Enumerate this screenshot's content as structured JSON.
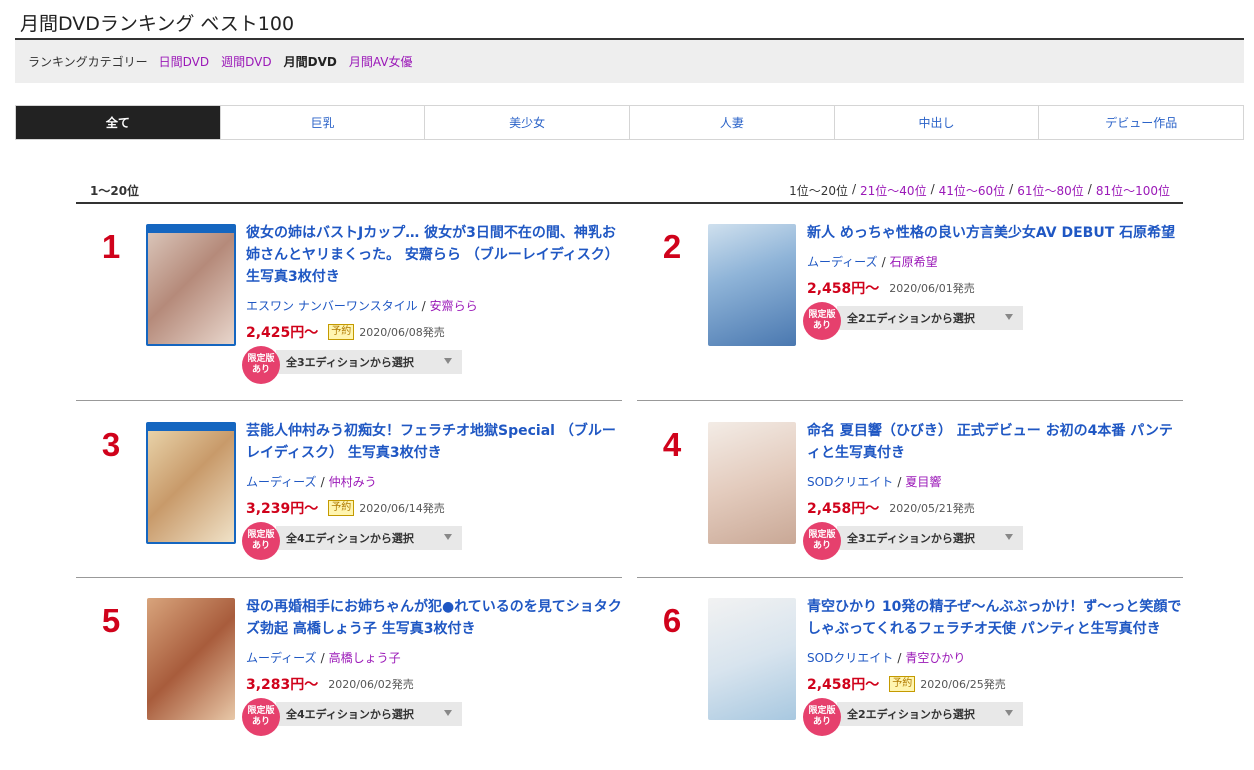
{
  "page_title": "月間DVDランキング ベスト100",
  "category_bar": {
    "label": "ランキングカテゴリー",
    "links": [
      {
        "label": "日間DVD",
        "active": false
      },
      {
        "label": "週間DVD",
        "active": false
      },
      {
        "label": "月間DVD",
        "active": true
      },
      {
        "label": "月間AV女優",
        "active": false
      }
    ]
  },
  "tabs": [
    {
      "label": "全て",
      "active": true
    },
    {
      "label": "巨乳",
      "active": false
    },
    {
      "label": "美少女",
      "active": false
    },
    {
      "label": "人妻",
      "active": false
    },
    {
      "label": "中出し",
      "active": false
    },
    {
      "label": "デビュー作品",
      "active": false
    }
  ],
  "range": {
    "current": "1〜20位",
    "nav": [
      "1位〜20位",
      "21位〜40位",
      "41位〜60位",
      "61位〜80位",
      "81位〜100位"
    ]
  },
  "items": [
    {
      "rank": "1",
      "title": "彼女の姉はバストJカップ… 彼女が3日間不在の間、神乳お姉さんとヤリまくった。 安齋らら （ブルーレイディスク） 生写真3枚付き",
      "maker": "エスワン ナンバーワンスタイル",
      "actress": "安齋らら",
      "price": "2,425円〜",
      "reserve": "予約",
      "release": "2020/06/08発売",
      "badge": "限定版あり",
      "edition": "全3エディションから選択"
    },
    {
      "rank": "2",
      "title": "新人 めっちゃ性格の良い方言美少女AV DEBUT 石原希望",
      "maker": "ムーディーズ",
      "actress": "石原希望",
      "price": "2,458円〜",
      "reserve": "",
      "release": "2020/06/01発売",
      "badge": "限定版あり",
      "edition": "全2エディションから選択"
    },
    {
      "rank": "3",
      "title": "芸能人仲村みう初痴女！フェラチオ地獄Special （ブルーレイディスク） 生写真3枚付き",
      "maker": "ムーディーズ",
      "actress": "仲村みう",
      "price": "3,239円〜",
      "reserve": "予約",
      "release": "2020/06/14発売",
      "badge": "限定版あり",
      "edition": "全4エディションから選択"
    },
    {
      "rank": "4",
      "title": "命名 夏目響（ひびき） 正式デビュー お初の4本番 パンティと生写真付き",
      "maker": "SODクリエイト",
      "actress": "夏目響",
      "price": "2,458円〜",
      "reserve": "",
      "release": "2020/05/21発売",
      "badge": "限定版あり",
      "edition": "全3エディションから選択"
    },
    {
      "rank": "5",
      "title": "母の再婚相手にお姉ちゃんが犯●れているのを見てショタクズ勃起 高橋しょう子 生写真3枚付き",
      "maker": "ムーディーズ",
      "actress": "高橋しょう子",
      "price": "3,283円〜",
      "reserve": "",
      "release": "2020/06/02発売",
      "badge": "限定版あり",
      "edition": "全4エディションから選択"
    },
    {
      "rank": "6",
      "title": "青空ひかり 10発の精子ぜ〜んぶぶっかけ！ず〜っと笑顔でしゃぶってくれるフェラチオ天使 パンティと生写真付き",
      "maker": "SODクリエイト",
      "actress": "青空ひかり",
      "price": "2,458円〜",
      "reserve": "予約",
      "release": "2020/06/25発売",
      "badge": "限定版あり",
      "edition": "全2エディションから選択"
    }
  ]
}
